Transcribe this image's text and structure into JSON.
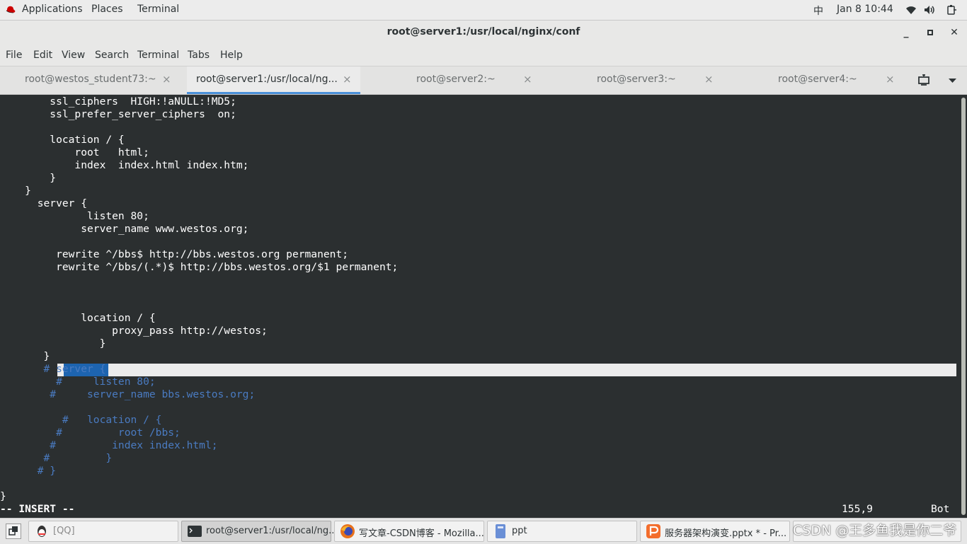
{
  "topbar": {
    "applications": "Applications",
    "places": "Places",
    "terminal": "Terminal",
    "input_method": "中",
    "datetime": "Jan 8  10:44"
  },
  "window": {
    "title": "root@server1:/usr/local/nginx/conf"
  },
  "menu": [
    "File",
    "Edit",
    "View",
    "Search",
    "Terminal",
    "Tabs",
    "Help"
  ],
  "tabs": [
    {
      "label": "root@westos_student73:~",
      "close": "×"
    },
    {
      "label": "root@server1:/usr/local/ng...",
      "close": "×"
    },
    {
      "label": "root@server2:~",
      "close": "×"
    },
    {
      "label": "root@server3:~",
      "close": "×"
    },
    {
      "label": "root@server4:~",
      "close": "×"
    }
  ],
  "terminal": {
    "lines": [
      "        ssl_ciphers  HIGH:!aNULL:!MD5;",
      "        ssl_prefer_server_ciphers  on;",
      "",
      "        location / {",
      "            root   html;",
      "            index  index.html index.htm;",
      "        }",
      "    }",
      "      server {",
      "              listen 80;",
      "             server_name www.westos.org;",
      "",
      "         rewrite ^/bbs$ http://bbs.westos.org permanent;",
      "         rewrite ^/bbs/(.*)$ http://bbs.westos.org/$1 permanent;",
      "",
      "",
      "",
      "             location / {",
      "                  proxy_pass http://westos;",
      "                }",
      "       }",
      "       # server {",
      "         #     listen 80;",
      "        #     server_name bbs.westos.org;",
      "",
      "          #   location / {",
      "         #         root /bbs;",
      "        #         index index.html;",
      "       #         }",
      "      # }",
      "",
      "}"
    ],
    "mode": "-- INSERT --",
    "position": "155,9",
    "scroll": "Bot"
  },
  "taskbar": [
    {
      "label": "[QQ]"
    },
    {
      "label": "root@server1:/usr/local/ng..."
    },
    {
      "label": "写文章-CSDN博客 - Mozilla..."
    },
    {
      "label": "ppt"
    },
    {
      "label": "服务器架构演变.pptx * - Pr..."
    }
  ],
  "watermark": "CSDN @王多鱼我是你二爷",
  "colors": {
    "terminal_bg": "#2b2f30",
    "comment": "#4a7bc1",
    "selection": "#1d64b0",
    "tab_accent": "#4a90d9"
  }
}
